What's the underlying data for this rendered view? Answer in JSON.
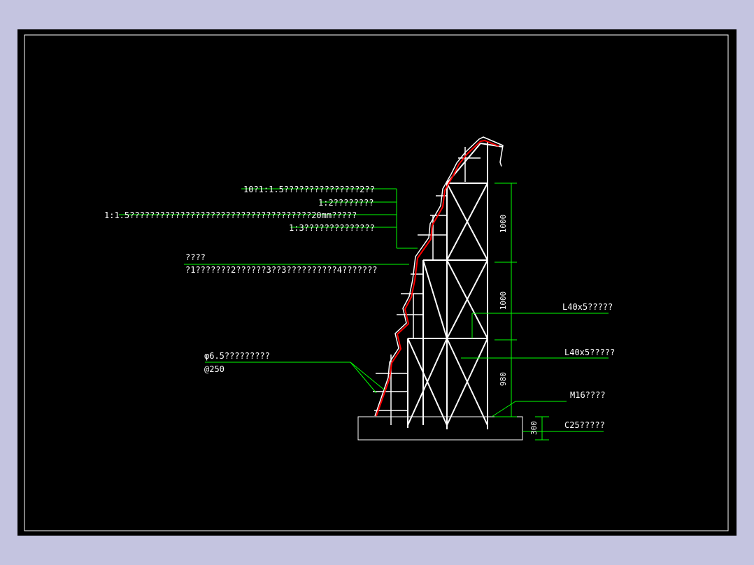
{
  "colors": {
    "background": "#000000",
    "outer_margin": "#c4c4e0",
    "structure": "#ffffff",
    "leader": "#00ff00",
    "surface": "#ff0000"
  },
  "annotations": {
    "left": {
      "layer1": "10?1:1.5???????????????2??",
      "layer2": "1:2????????",
      "layer3": "1:1.5????????????????????????????????????20mm?????",
      "layer4": "1:3??????????????",
      "title": "????",
      "detail": "?1???????2??????3??3??????????4???????",
      "rebar_spec": "φ6.5?????????",
      "rebar_spacing": "@250"
    },
    "right": {
      "angle_steel_1": "L40x5?????",
      "angle_steel_2": "L40x5?????",
      "anchor_bolt": "M16????",
      "foundation": "C25?????"
    }
  },
  "dimensions": {
    "upper": "1000",
    "middle": "1000",
    "lower": "980",
    "foundation": "300"
  }
}
